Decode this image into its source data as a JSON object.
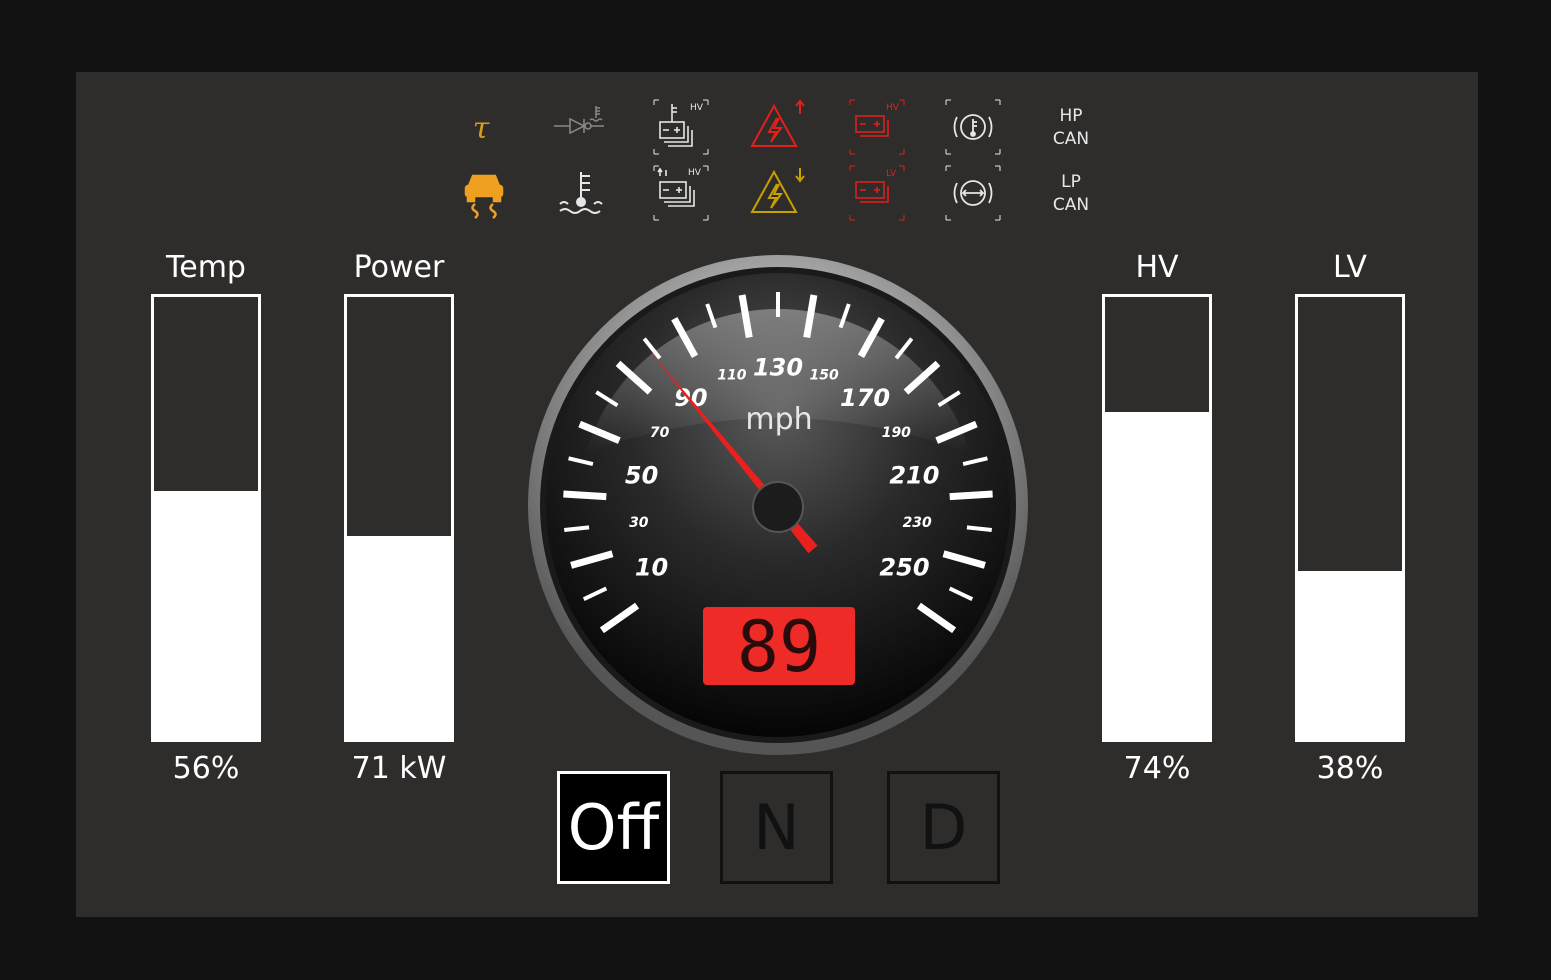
{
  "indicators": {
    "row1": [
      {
        "icon": "tau-icon",
        "color": "#d4a017"
      },
      {
        "icon": "coolant-sensor-diode-icon",
        "color": "#8a8a8a"
      },
      {
        "icon": "hv-battery-temperature-icon",
        "color": "#e6e6e6",
        "label": "HV"
      },
      {
        "icon": "high-voltage-up-warning-icon",
        "color": "#e0201a"
      },
      {
        "icon": "hv-battery-fault-icon",
        "color": "#e0201a",
        "label": "HV"
      },
      {
        "icon": "brake-temperature-icon",
        "color": "#e6e6e6"
      }
    ],
    "row2": [
      {
        "icon": "traction-control-icon",
        "color": "#f0a020"
      },
      {
        "icon": "coolant-temperature-icon",
        "color": "#e6e6e6"
      },
      {
        "icon": "hv-battery-charge-icon",
        "color": "#e6e6e6",
        "label": "HV"
      },
      {
        "icon": "high-voltage-down-warning-icon",
        "color": "#c8a000"
      },
      {
        "icon": "lv-battery-fault-icon",
        "color": "#e0201a",
        "label": "LV"
      },
      {
        "icon": "brake-pad-icon",
        "color": "#e6e6e6"
      }
    ],
    "hp_can": {
      "line1": "HP",
      "line2": "CAN"
    },
    "lp_can": {
      "line1": "LP",
      "line2": "CAN"
    }
  },
  "bars": [
    {
      "id": "temp",
      "label": "Temp",
      "value_text": "56%",
      "fill": 0.56
    },
    {
      "id": "power",
      "label": "Power",
      "value_text": "71 kW",
      "fill": 0.46
    },
    {
      "id": "hv",
      "label": "HV",
      "value_text": "74%",
      "fill": 0.74
    },
    {
      "id": "lv",
      "label": "LV",
      "value_text": "38%",
      "fill": 0.38
    }
  ],
  "speedometer": {
    "unit": "mph",
    "speed": 89,
    "readout": "89",
    "min": 0,
    "max": 260,
    "major_labels": [
      "10",
      "50",
      "90",
      "130",
      "170",
      "210",
      "250"
    ],
    "minor_labels": [
      "30",
      "70",
      "110",
      "150",
      "190",
      "230"
    ],
    "needle_color": "#e8201e",
    "readout_bg": "#ef2b27"
  },
  "gears": [
    {
      "label": "Off",
      "active": true
    },
    {
      "label": "N",
      "active": false
    },
    {
      "label": "D",
      "active": false
    }
  ]
}
